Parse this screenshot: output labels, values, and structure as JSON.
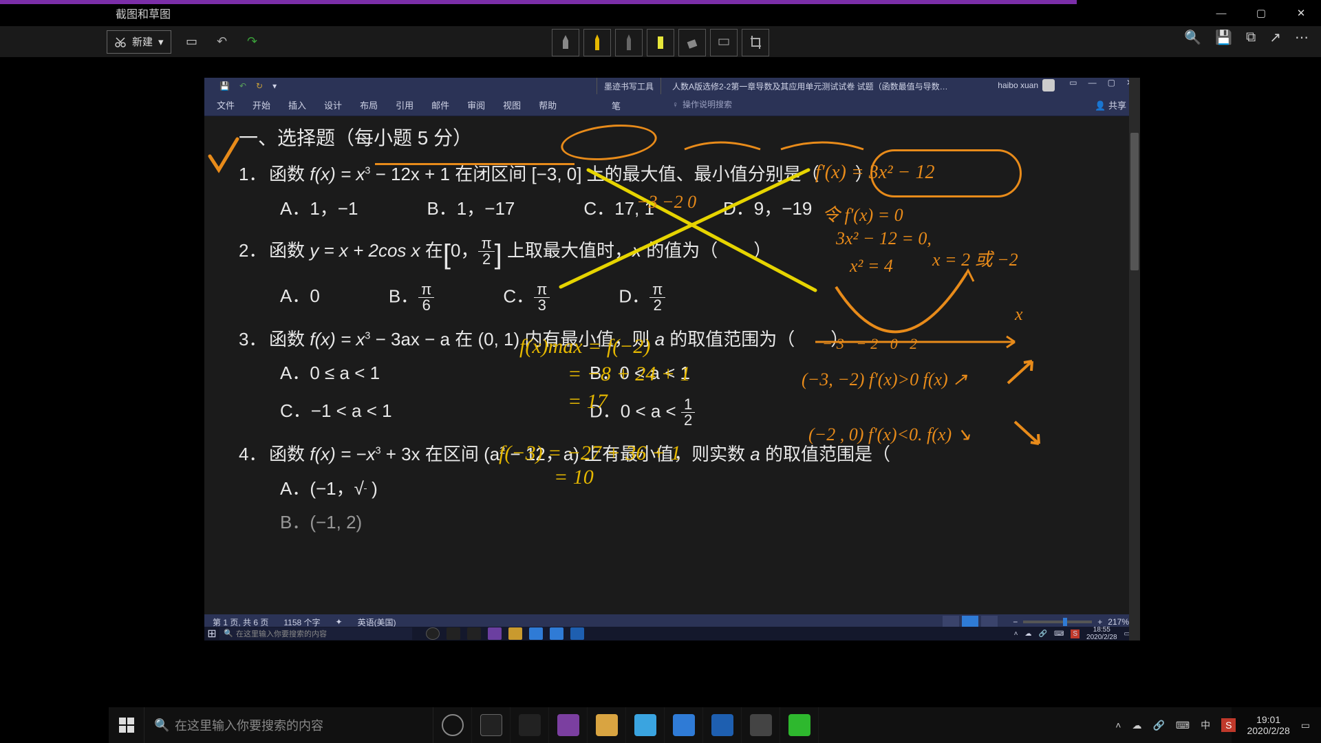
{
  "snip": {
    "title": "截图和草图",
    "new_label": "新建",
    "sys": {
      "min": "—",
      "max": "▢",
      "close": "✕"
    },
    "right_icons": {
      "zoom": "🔍",
      "save": "💾",
      "copy": "⧉",
      "share": "↗",
      "more": "⋯"
    }
  },
  "word": {
    "qat": {
      "save": "💾",
      "undo": "↶",
      "redo": "↻",
      "more": "▾"
    },
    "ink_tab": "墨迹书写工具",
    "doc_title": "人数A版选修2-2第一章导数及其应用单元测试试卷 试题（函数最值与导数…",
    "user": "haibo xuan",
    "winbtns": {
      "ribbon": "▭",
      "min": "—",
      "max": "▢",
      "close": "✕"
    },
    "tabs": {
      "file": "文件",
      "home": "开始",
      "insert": "插入",
      "design": "设计",
      "layout": "布局",
      "ref": "引用",
      "mail": "邮件",
      "review": "审阅",
      "view": "视图",
      "help": "帮助",
      "pen": "笔"
    },
    "search_hint": "操作说明搜索",
    "share": "共享",
    "status": {
      "page": "第 1 页, 共 6 页",
      "words": "1158 个字",
      "lang": "英语(美国)",
      "zoom": "217%"
    }
  },
  "doc": {
    "heading": "一、选择题（每小题 5 分）",
    "q1": {
      "num": "1．",
      "text_a": "函数 ",
      "fx": "f(x) = x",
      "sup": "3",
      "text_b": " − 12x + 1 在闭区间 [−3, 0] 上的最大值、最小值分别是（　　）",
      "opts": {
        "A": "A．1，−1",
        "B": "B．1，−17",
        "C": "C．17, 1",
        "D": "D．9，−19"
      }
    },
    "q2": {
      "num": "2．",
      "text_a": "函数 ",
      "eq": "y = x + 2cos x",
      "text_b": " 在",
      "rb": " 上取最大值时，",
      "xv": "x",
      "text_c": " 的值为（　　）",
      "opts": {
        "A": "A．0",
        "B": "B．",
        "C": "C．",
        "D": "D．"
      },
      "fracs": {
        "B_top": "π",
        "B_bot": "6",
        "C_top": "π",
        "C_bot": "3",
        "D_top": "π",
        "D_bot": "2",
        "int_top": "π",
        "int_bot": "2"
      }
    },
    "q3": {
      "num": "3．",
      "text_a": "函数 ",
      "fx": "f(x) = x",
      "sup": "3",
      "text_b": " − 3ax − a 在 (0, 1) 内有最小值，则 ",
      "av": "a",
      "text_c": " 的取值范围为（　　）",
      "opts": {
        "A": "A．0 ≤ a < 1",
        "B": "B．0 < a < 1",
        "C": "C．−1 < a < 1",
        "D": "D．0 < a < "
      },
      "D_top": "1",
      "D_bot": "2"
    },
    "q4": {
      "num": "4．",
      "text_a": "函数 ",
      "fx": "f(x) = −x",
      "sup": "3",
      "text_b": " + 3x 在区间 (a",
      "sup2": "2",
      "text_c": " − 12，a) 上有最小值，则实数 ",
      "av": "a",
      "text_d": " 的取值范围是（",
      "opts": {
        "A": "A．(−1，",
        "rad": "11",
        "A_end": " )",
        "B": "B．(−1, 2)"
      }
    }
  },
  "annot": {
    "fprime": "f'(x) = 3x² − 12",
    "let0": "令 f'(x) = 0",
    "eq1": "3x² − 12 = 0,",
    "eq2": "x² = 4",
    "eq3": "x = 2 或 −2",
    "nums": "−3   −2        0",
    "xarrow": "x",
    "axis": "−3   −2   0   2",
    "interval1": "(−3, −2)  f'(x)>0  f(x) ↗",
    "interval2": "(−2 , 0)   f'(x)<0.  f(x) ↘",
    "fmax": "f(x)max = f(−2)",
    "fmax2": "= −8 + 24 + 1",
    "fmax3": "= 17",
    "fm3": "f(−3) = −27 + 36 + 1",
    "fm3b": "= 10"
  },
  "inner_tb": {
    "search": "在这里输入你要搜索的内容",
    "time": "18:55",
    "date": "2020/2/28"
  },
  "outer_tb": {
    "search": "在这里输入你要搜索的内容",
    "time": "19:01",
    "date": "2020/2/28"
  }
}
